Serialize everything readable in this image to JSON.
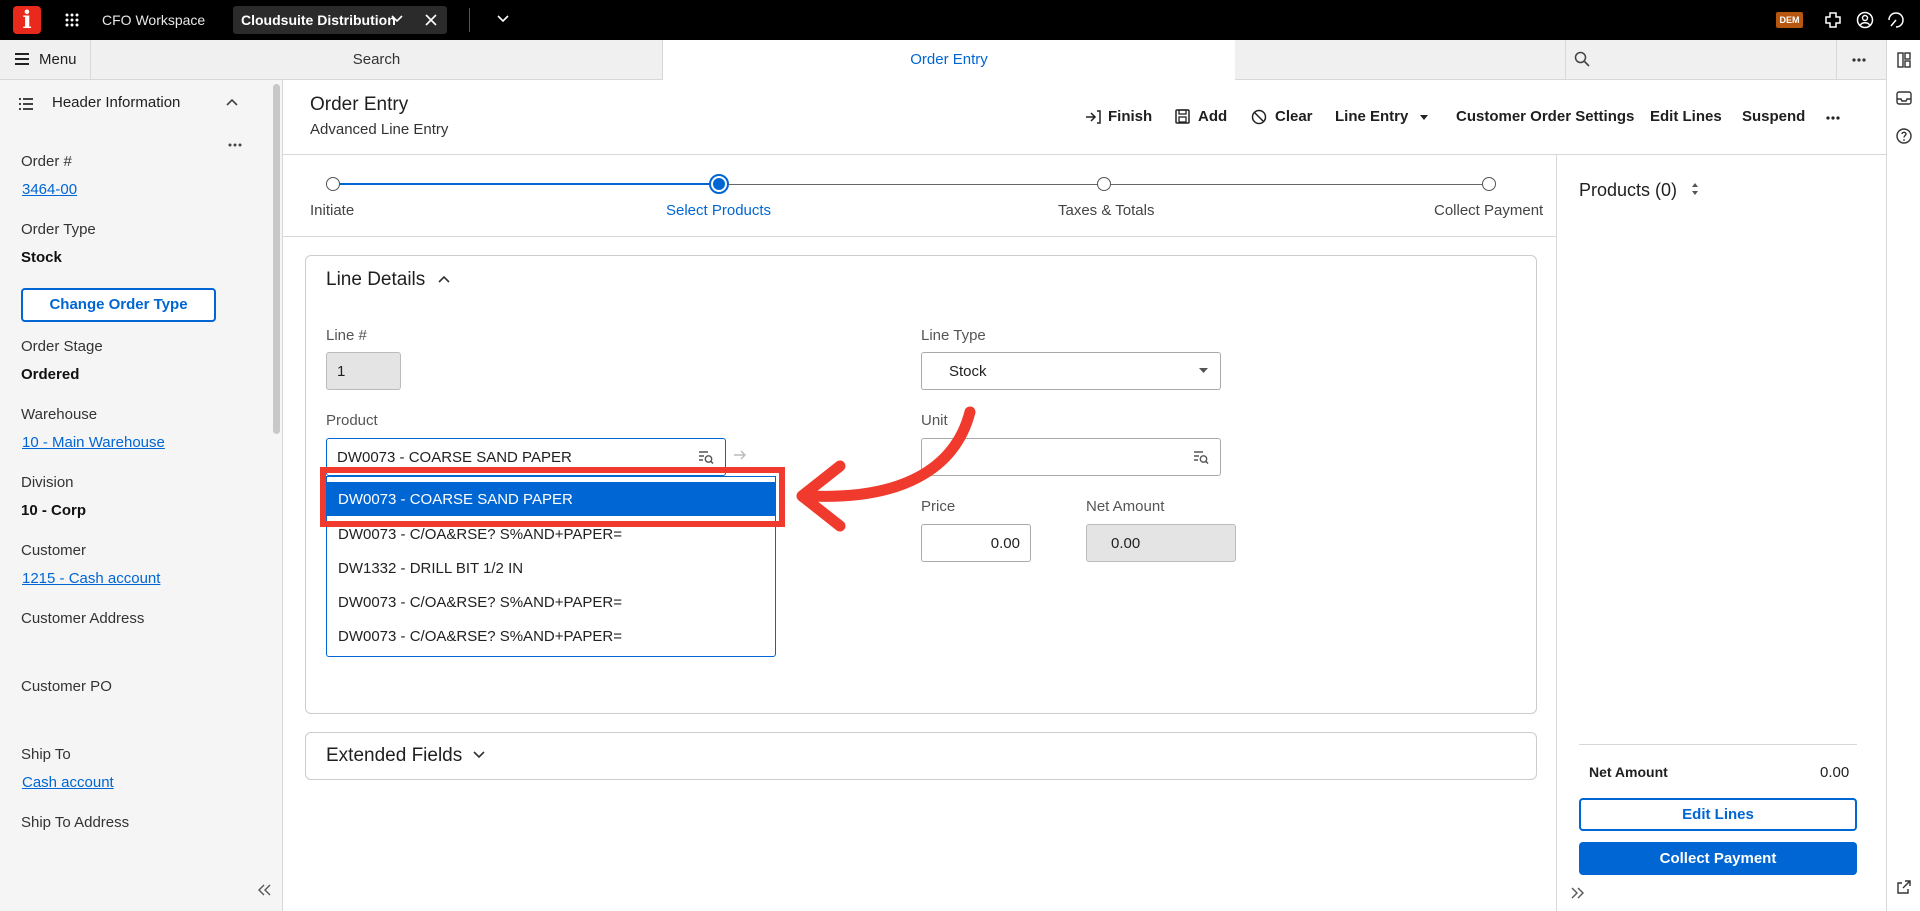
{
  "topbar": {
    "logo_letter": "i",
    "app_name": "CFO Workspace",
    "context_tab": "Cloudsuite Distribution",
    "user_badge": "DEM"
  },
  "tabstrip": {
    "menu_label": "Menu",
    "search_tab": "Search",
    "active_tab": "Order Entry"
  },
  "left_panel": {
    "title": "Header Information",
    "order_no_label": "Order #",
    "order_no": "3464-00",
    "order_type_label": "Order Type",
    "order_type": "Stock",
    "change_order_type_button": "Change Order Type",
    "order_stage_label": "Order Stage",
    "order_stage": "Ordered",
    "warehouse_label": "Warehouse",
    "warehouse": "10 - Main Warehouse",
    "division_label": "Division",
    "division": "10 - Corp",
    "customer_label": "Customer",
    "customer": "1215 - Cash account",
    "customer_address_label": "Customer Address",
    "customer_po_label": "Customer PO",
    "ship_to_label": "Ship To",
    "ship_to": "Cash account",
    "ship_to_address_label": "Ship To Address"
  },
  "page": {
    "title": "Order Entry",
    "subtitle": "Advanced Line Entry",
    "actions": {
      "finish": "Finish",
      "add": "Add",
      "clear": "Clear",
      "line_entry": "Line Entry",
      "customer_order_settings": "Customer Order Settings",
      "edit_lines": "Edit Lines",
      "suspend": "Suspend"
    }
  },
  "stepper": {
    "steps": [
      "Initiate",
      "Select Products",
      "Taxes & Totals",
      "Collect Payment"
    ],
    "active_index": 1
  },
  "line_details": {
    "title": "Line Details",
    "line_no_label": "Line #",
    "line_no": "1",
    "line_type_label": "Line Type",
    "line_type": "Stock",
    "product_label": "Product",
    "product_value": "DW0073 - COARSE SAND PAPER",
    "unit_label": "Unit",
    "price_label": "Price",
    "price": "0.00",
    "net_amount_label": "Net Amount",
    "net_amount": "0.00",
    "suggestions": [
      "DW0073 - COARSE SAND PAPER",
      "DW0073 - C/OA&RSE? S%AND+PAPER=",
      "DW1332 - DRILL BIT 1/2 IN",
      "DW0073 - C/OA&RSE? S%AND+PAPER=",
      "DW0073 - C/OA&RSE? S%AND+PAPER="
    ],
    "highlighted_index": 0
  },
  "extended_fields": {
    "title": "Extended Fields"
  },
  "products_panel": {
    "title": "Products (0)",
    "net_amount_label": "Net Amount",
    "net_amount": "0.00",
    "edit_lines_button": "Edit Lines",
    "collect_payment_button": "Collect Payment"
  },
  "colors": {
    "accent": "#0066d4",
    "annotation": "#f03a2e",
    "logo": "#e8291c"
  }
}
